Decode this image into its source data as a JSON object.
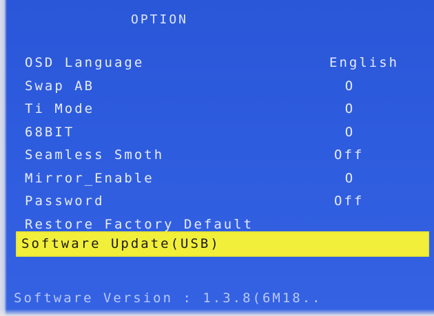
{
  "header": {
    "title": "OPTION"
  },
  "menu": {
    "items": [
      {
        "label": "OSD Language",
        "value": "English"
      },
      {
        "label": "Swap AB",
        "value": "O"
      },
      {
        "label": "Ti Mode",
        "value": "O"
      },
      {
        "label": "68BIT",
        "value": "O"
      },
      {
        "label": "Seamless Smoth",
        "value": "Off"
      },
      {
        "label": "Mirror_Enable",
        "value": "O"
      },
      {
        "label": "Password",
        "value": "Off"
      },
      {
        "label": "Restore Factory Default",
        "value": ""
      },
      {
        "label": "Software Update(USB)",
        "value": ""
      }
    ],
    "selected_index": 8
  },
  "footer": {
    "software_version": "Software Version : 1.3.8(6M18.."
  },
  "colors": {
    "background": "#2e5cde",
    "text": "#e8ecff",
    "highlight": "#f2ef3a",
    "highlight_text": "#1a1a10"
  }
}
